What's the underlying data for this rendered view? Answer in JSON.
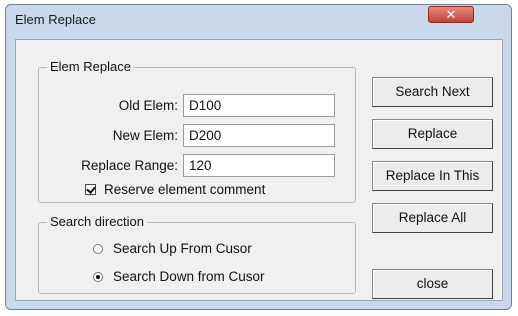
{
  "window": {
    "title": "Elem Replace",
    "close_glyph": "✕"
  },
  "group_replace": {
    "title": "Elem Replace",
    "old_label": "Old Elem:",
    "old_value": "D100",
    "new_label": "New Elem:",
    "new_value": "D200",
    "range_label": "Replace Range:",
    "range_value": "120",
    "reserve_label": "Reserve element comment",
    "reserve_checked": true
  },
  "group_direction": {
    "title": "Search direction",
    "up_label": "Search Up From Cusor",
    "down_label": "Search Down from Cusor",
    "selected": "down"
  },
  "buttons": {
    "search_next": "Search  Next",
    "replace": "Replace",
    "replace_in_this": "Replace In This",
    "replace_all": "Replace All",
    "close": "close"
  }
}
